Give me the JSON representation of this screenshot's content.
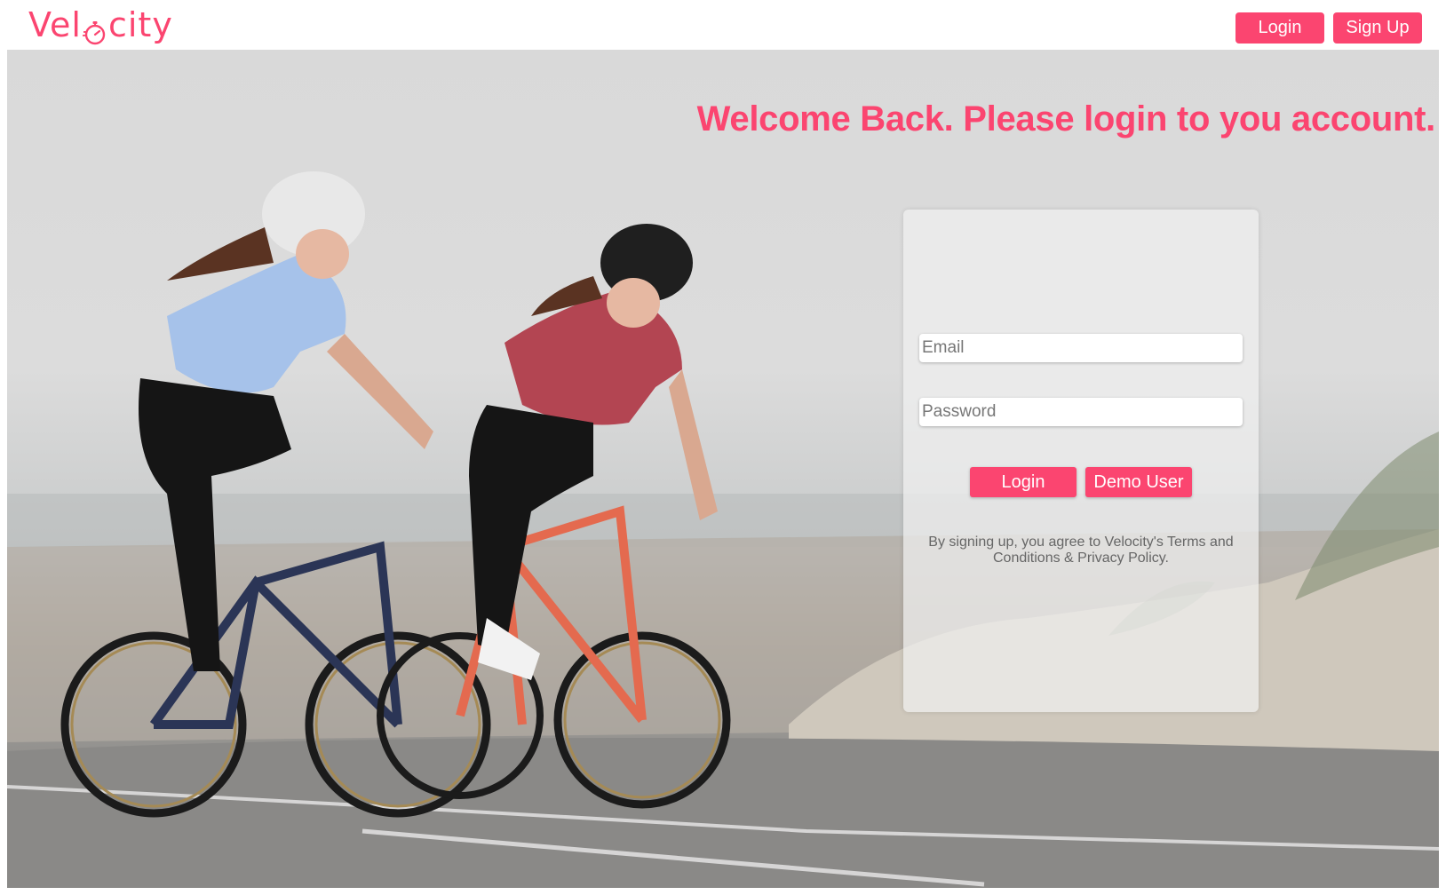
{
  "colors": {
    "brand": "#fb4570"
  },
  "navbar": {
    "logo_prefix": "Vel",
    "logo_suffix": "city",
    "logo_icon": "stopwatch-icon",
    "login_label": "Login",
    "signup_label": "Sign Up"
  },
  "hero": {
    "headline": "Welcome Back. Please login to you account."
  },
  "login_form": {
    "email_placeholder": "Email",
    "email_value": "",
    "password_placeholder": "Password",
    "password_value": "",
    "login_label": "Login",
    "demo_label": "Demo User",
    "terms": "By signing up, you agree to Velocity's Terms and Conditions & Privacy Policy."
  }
}
